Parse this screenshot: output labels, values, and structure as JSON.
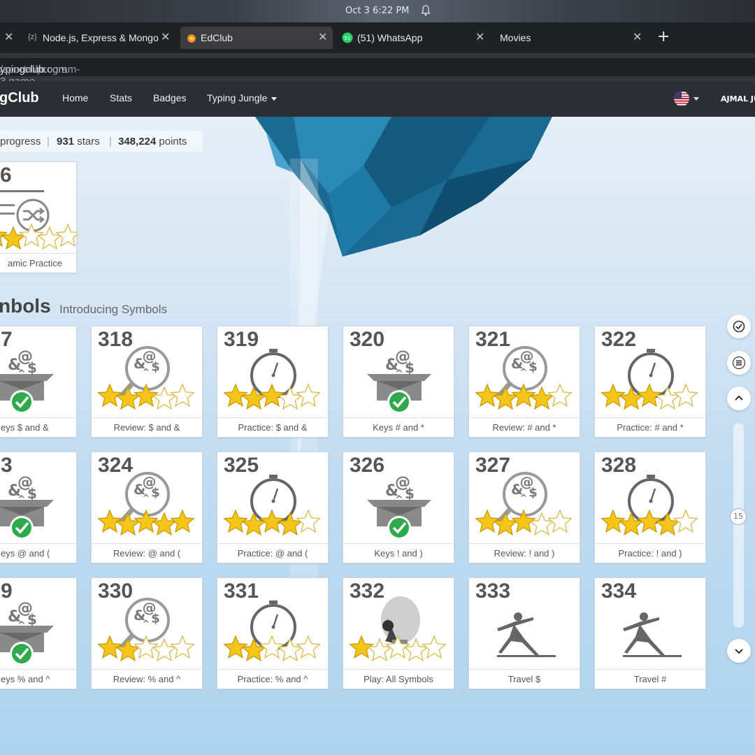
{
  "os": {
    "clock": "Oct 3   6:22 PM",
    "bell_icon": "bell-icon"
  },
  "tabs": [
    {
      "label": "Node.js, Express & Mongo",
      "icon": "code-icon",
      "active": false
    },
    {
      "label": "EdClub",
      "icon": "edclub-icon",
      "active": true
    },
    {
      "label": "(51) WhatsApp",
      "icon": "whatsapp-icon",
      "active": false
    },
    {
      "label": "Movies",
      "icon": "",
      "active": false
    }
  ],
  "address": {
    "host": "ypingclub.com",
    "path": "/sportal/program-3.game"
  },
  "navbar": {
    "brand": "gClub",
    "links": [
      "Home",
      "Stats",
      "Badges",
      "Typing Jungle"
    ],
    "user": "AJMAL JU"
  },
  "progress": {
    "label": "progress",
    "stars_value": "931",
    "stars_label": "stars",
    "points_value": "348,224",
    "points_label": "points"
  },
  "top_card": {
    "num": "6",
    "caption": "amic Practice",
    "stars": 2
  },
  "section": {
    "title": "nbols",
    "subtitle": "Introducing Symbols"
  },
  "cards": [
    {
      "num": "7",
      "caption": "eys $ and &",
      "type": "keys",
      "stars": 0
    },
    {
      "num": "318",
      "caption": "Review: $ and &",
      "type": "review",
      "stars": 3
    },
    {
      "num": "319",
      "caption": "Practice: $ and &",
      "type": "practice",
      "stars": 3
    },
    {
      "num": "320",
      "caption": "Keys # and *",
      "type": "keys",
      "stars": 0
    },
    {
      "num": "321",
      "caption": "Review: # and *",
      "type": "review",
      "stars": 4
    },
    {
      "num": "322",
      "caption": "Practice: # and *",
      "type": "practice",
      "stars": 3
    },
    {
      "num": "3",
      "caption": "eys @ and (",
      "type": "keys",
      "stars": 0
    },
    {
      "num": "324",
      "caption": "Review: @ and (",
      "type": "review",
      "stars": 5
    },
    {
      "num": "325",
      "caption": "Practice: @ and (",
      "type": "practice",
      "stars": 4
    },
    {
      "num": "326",
      "caption": "Keys ! and )",
      "type": "keys",
      "stars": 0
    },
    {
      "num": "327",
      "caption": "Review: ! and )",
      "type": "review",
      "stars": 3
    },
    {
      "num": "328",
      "caption": "Practice: ! and )",
      "type": "practice",
      "stars": 4
    },
    {
      "num": "9",
      "caption": "eys % and ^",
      "type": "keys",
      "stars": 0
    },
    {
      "num": "330",
      "caption": "Review: % and ^",
      "type": "review",
      "stars": 2
    },
    {
      "num": "331",
      "caption": "Practice: % and ^",
      "type": "practice",
      "stars": 2
    },
    {
      "num": "332",
      "caption": "Play: All Symbols",
      "type": "play",
      "stars": 1
    },
    {
      "num": "333",
      "caption": "Travel $",
      "type": "travel",
      "stars": -1
    },
    {
      "num": "334",
      "caption": "Travel #",
      "type": "travel",
      "stars": -1
    }
  ],
  "scroll": {
    "page_number": "15"
  },
  "colors": {
    "navbar": "#2b2f33",
    "star_gold": "#f5c518",
    "check_green": "#2eaa4a"
  }
}
